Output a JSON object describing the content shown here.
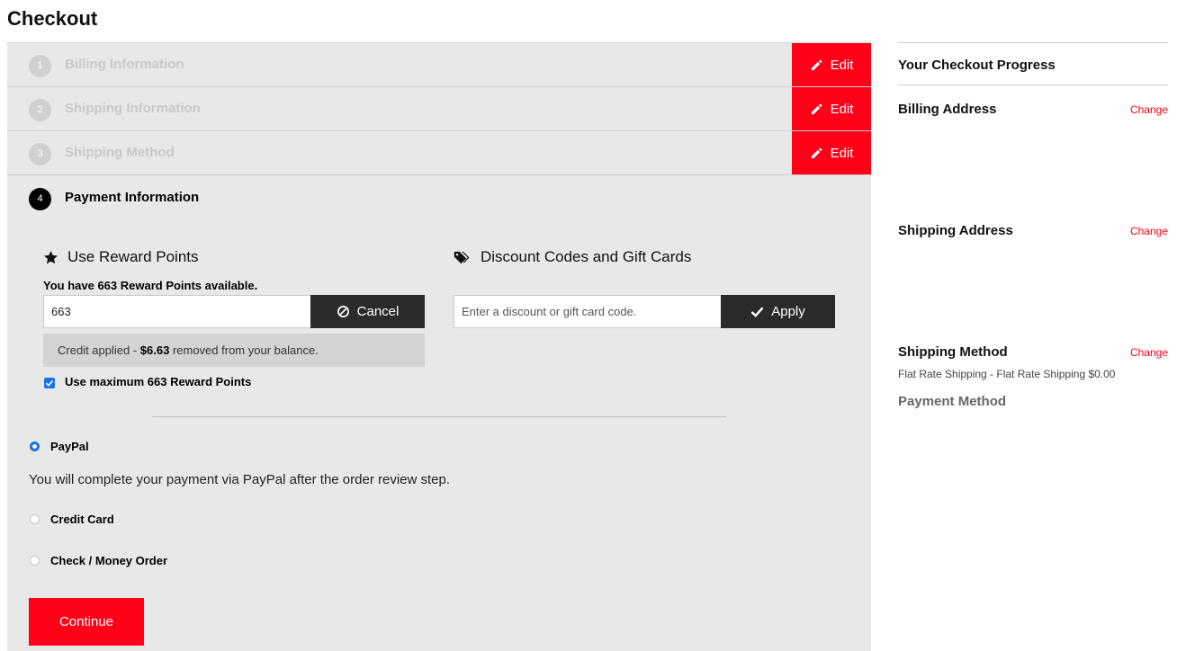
{
  "page": {
    "title": "Checkout"
  },
  "steps": [
    {
      "number": "1",
      "title": "Billing Information",
      "edit_label": "Edit"
    },
    {
      "number": "2",
      "title": "Shipping Information",
      "edit_label": "Edit"
    },
    {
      "number": "3",
      "title": "Shipping Method",
      "edit_label": "Edit"
    }
  ],
  "active_step": {
    "number": "4",
    "title": "Payment Information"
  },
  "reward": {
    "heading": "Use Reward Points",
    "available_text": "You have 663 Reward Points available.",
    "input_value": "663",
    "cancel_label": "Cancel",
    "credit_prefix": "Credit applied - ",
    "credit_amount": "$6.63",
    "credit_suffix": " removed from your balance.",
    "use_max_label": "Use maximum 663 Reward Points",
    "use_max_checked": true
  },
  "discount": {
    "heading": "Discount Codes and Gift Cards",
    "placeholder": "Enter a discount or gift card code.",
    "apply_label": "Apply"
  },
  "payment_methods": [
    {
      "label": "PayPal",
      "selected": true
    },
    {
      "label": "Credit Card",
      "selected": false
    },
    {
      "label": "Check / Money Order",
      "selected": false
    }
  ],
  "paypal_note": "You will complete your payment via PayPal after the order review step.",
  "continue_label": "Continue",
  "sidebar": {
    "title": "Your Checkout Progress",
    "billing_address": {
      "label": "Billing Address",
      "change": "Change"
    },
    "shipping_address": {
      "label": "Shipping Address",
      "change": "Change"
    },
    "shipping_method": {
      "label": "Shipping Method",
      "change": "Change",
      "detail": "Flat Rate Shipping - Flat Rate Shipping $0.00"
    },
    "payment_method": {
      "label": "Payment Method"
    }
  },
  "colors": {
    "accent": "#ff0018",
    "dark_button": "#2b2b2b",
    "panel": "#e8e8e8",
    "radio": "#1a73e8"
  },
  "icons": {
    "edit": "pencil-icon",
    "cancel": "ban-icon",
    "apply": "check-icon",
    "reward": "star-icon",
    "discount": "tags-icon"
  }
}
